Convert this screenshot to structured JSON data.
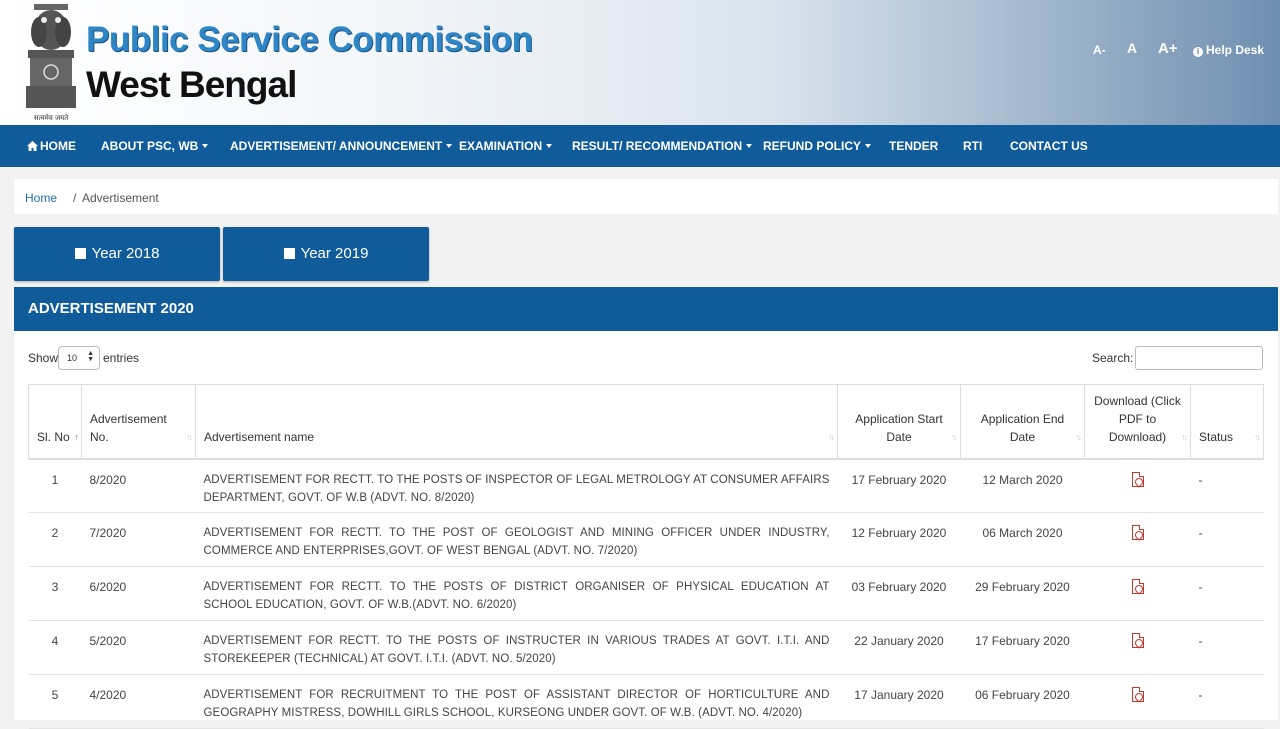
{
  "header": {
    "title_line1": "Public Service Commission",
    "title_line2": "West Bengal",
    "emblem_motto": "सत्यमेव जयते",
    "font_controls": [
      "A-",
      "A",
      "A+"
    ],
    "help_desk": "Help Desk"
  },
  "nav": {
    "items": [
      {
        "label": "HOME",
        "dropdown": false,
        "icon": "home-icon"
      },
      {
        "label": "ABOUT PSC, WB",
        "dropdown": true
      },
      {
        "label": "ADVERTISEMENT/ ANNOUNCEMENT",
        "dropdown": true
      },
      {
        "label": "EXAMINATION",
        "dropdown": true
      },
      {
        "label": "RESULT/ RECOMMENDATION",
        "dropdown": true
      },
      {
        "label": "REFUND POLICY",
        "dropdown": true
      },
      {
        "label": "TENDER",
        "dropdown": false
      },
      {
        "label": "RTI",
        "dropdown": false
      },
      {
        "label": "CONTACT US",
        "dropdown": false
      }
    ]
  },
  "breadcrumb": {
    "home": "Home",
    "separator": "/",
    "current": "Advertisement"
  },
  "year_buttons": [
    "Year 2018",
    "Year 2019"
  ],
  "panel": {
    "title": "ADVERTISEMENT 2020",
    "show_label": "Show",
    "entries_value": "10",
    "entries_label": "entries",
    "search_label": "Search:",
    "search_value": ""
  },
  "table": {
    "columns": [
      {
        "label": "Sl. No"
      },
      {
        "label": "Advertisement No."
      },
      {
        "label": "Advertisement name"
      },
      {
        "label": "Application Start Date"
      },
      {
        "label": "Application End Date"
      },
      {
        "label": "Download (Click PDF to Download)"
      },
      {
        "label": "Status"
      }
    ],
    "rows": [
      {
        "sl": "1",
        "adv_no": "8/2020",
        "name": "ADVERTISEMENT FOR RECTT. TO THE POSTS OF INSPECTOR OF LEGAL METROLOGY AT CONSUMER AFFAIRS DEPARTMENT, GOVT. OF W.B (ADVT. NO. 8/2020)",
        "start": "17 February 2020",
        "end": "12 March 2020",
        "status": "-"
      },
      {
        "sl": "2",
        "adv_no": "7/2020",
        "name": "ADVERTISEMENT FOR RECTT. TO THE POST OF GEOLOGIST AND MINING OFFICER UNDER INDUSTRY, COMMERCE AND ENTERPRISES,GOVT. OF WEST BENGAL (ADVT. NO. 7/2020)",
        "start": "12 February 2020",
        "end": "06 March 2020",
        "status": "-"
      },
      {
        "sl": "3",
        "adv_no": "6/2020",
        "name": "ADVERTISEMENT FOR RECTT. TO THE POSTS OF DISTRICT ORGANISER OF PHYSICAL EDUCATION AT SCHOOL EDUCATION, GOVT. OF W.B.(ADVT. NO. 6/2020)",
        "start": "03 February 2020",
        "end": "29 February 2020",
        "status": "-"
      },
      {
        "sl": "4",
        "adv_no": "5/2020",
        "name": "ADVERTISEMENT FOR RECTT. TO THE POSTS OF INSTRUCTER IN VARIOUS TRADES AT GOVT. I.T.I. AND STOREKEEPER (TECHNICAL) AT GOVT. I.T.I. (ADVT. NO. 5/2020)",
        "start": "22 January 2020",
        "end": "17 February 2020",
        "status": "-"
      },
      {
        "sl": "5",
        "adv_no": "4/2020",
        "name": "ADVERTISEMENT FOR RECRUITMENT TO THE POST OF ASSISTANT DIRECTOR OF HORTICULTURE AND GEOGRAPHY MISTRESS, DOWHILL GIRLS SCHOOL, KURSEONG UNDER GOVT. OF W.B. (ADVT. NO. 4/2020)",
        "start": "17 January 2020",
        "end": "06 February 2020",
        "status": "-"
      }
    ]
  }
}
